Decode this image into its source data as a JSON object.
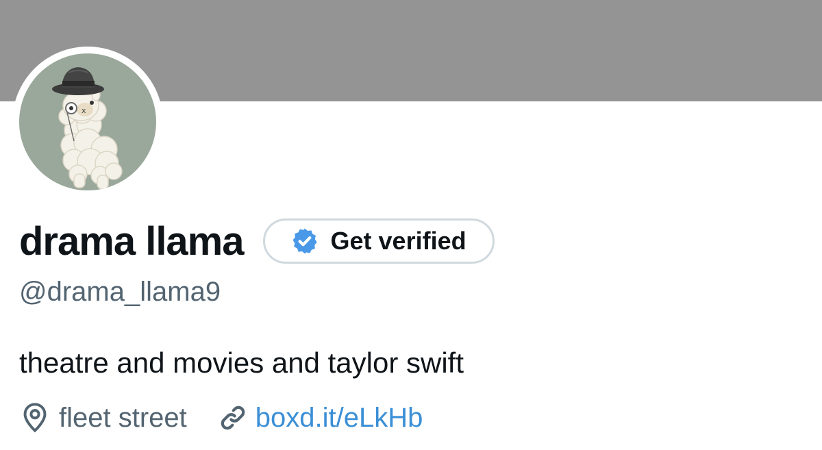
{
  "profile": {
    "display_name": "drama llama",
    "handle": "@drama_llama9",
    "bio": "theatre and movies and taylor swift",
    "location": "fleet street",
    "website": "boxd.it/eLkHb",
    "avatar": "llama-with-hat-and-monocle"
  },
  "verify_button": {
    "label": "Get verified",
    "icon": "verified-badge-icon"
  },
  "icons": {
    "location": "location-pin-icon",
    "link": "link-icon"
  },
  "colors": {
    "banner": "#949494",
    "avatar_background": "#9aa89b",
    "text_primary": "#0f1419",
    "text_secondary": "#536471",
    "link": "#3b8fd6",
    "verified_badge": "#4a99e9",
    "button_border": "#cfd9de"
  }
}
